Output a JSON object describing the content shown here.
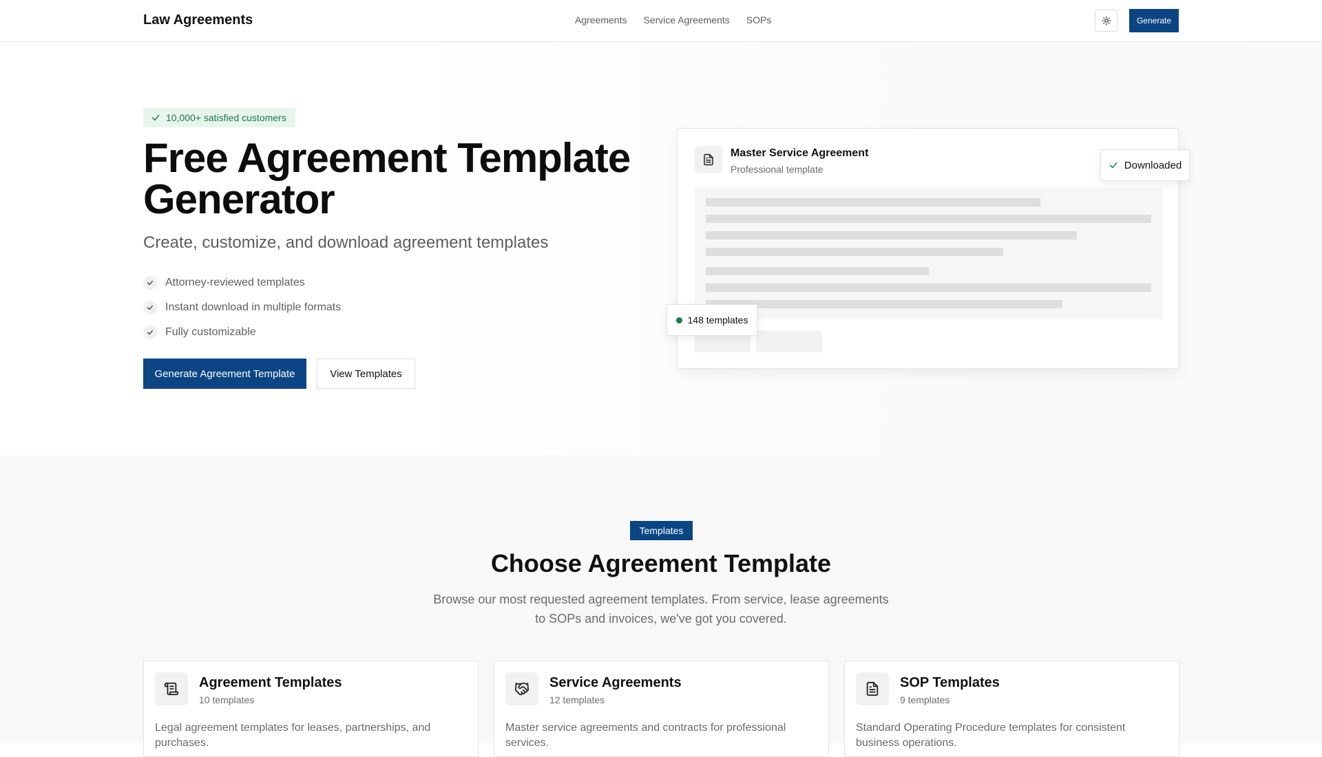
{
  "nav": {
    "brand": "Law Agreements",
    "links": [
      "Agreements",
      "Service Agreements",
      "SOPs"
    ],
    "generate_label": "Generate",
    "theme_icon": "sun-icon"
  },
  "hero": {
    "badge": "10,000+ satisfied customers",
    "title": "Free Agreement Template Generator",
    "subtitle": "Create, customize, and download agreement templates",
    "features": [
      "Attorney-reviewed templates",
      "Instant download in multiple formats",
      "Fully customizable"
    ],
    "primary_cta": "Generate Agreement Template",
    "secondary_cta": "View Templates"
  },
  "preview": {
    "title": "Master Service Agreement",
    "subtitle": "Professional template",
    "downloaded_label": "Downloaded",
    "templates_count": "148 templates"
  },
  "templates_section": {
    "badge": "Templates",
    "title": "Choose Agreement Template",
    "description": "Browse our most requested agreement templates. From service, lease agreements to SOPs and invoices, we've got you covered.",
    "cards": [
      {
        "title": "Agreement Templates",
        "count": "10 templates",
        "description": "Legal agreement templates for leases, partnerships, and purchases.",
        "icon": "scroll-icon"
      },
      {
        "title": "Service Agreements",
        "count": "12 templates",
        "description": "Master service agreements and contracts for professional services.",
        "icon": "handshake-icon"
      },
      {
        "title": "SOP Templates",
        "count": "9 templates",
        "description": "Standard Operating Procedure templates for consistent business operations.",
        "icon": "document-icon"
      }
    ]
  },
  "colors": {
    "primary": "#0b4584",
    "success_bg": "#e8f5ec",
    "success_text": "#1d7a43",
    "status_dot": "#15803d"
  }
}
